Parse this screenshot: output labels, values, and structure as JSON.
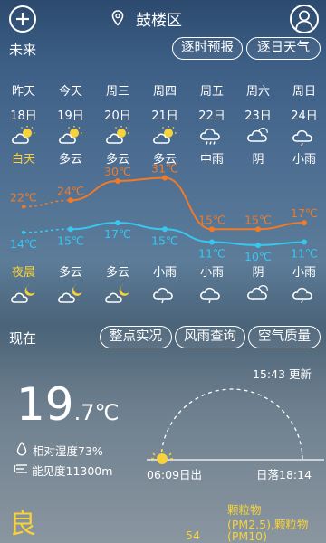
{
  "header": {
    "city": "鼓楼区",
    "add_icon": "plus-icon",
    "location_icon": "location-pin-icon",
    "user_icon": "user-icon"
  },
  "forecast": {
    "title": "未来",
    "hourly_button": "逐时预报",
    "daily_button": "逐日天气",
    "days": [
      {
        "day": "昨天",
        "date": "18日",
        "day_weather": "白天",
        "night_weather": "夜晨",
        "high": 22,
        "low": 14,
        "day_icon": "sunny-cloudy-icon",
        "night_icon": "moon-cloudy-icon",
        "high_label": "22℃",
        "low_label": "14℃"
      },
      {
        "day": "今天",
        "date": "19日",
        "day_weather": "多云",
        "night_weather": "多云",
        "high": 24,
        "low": 15,
        "day_icon": "sunny-cloudy-icon",
        "night_icon": "moon-cloudy-icon",
        "high_label": "24℃",
        "low_label": "15℃"
      },
      {
        "day": "周三",
        "date": "20日",
        "day_weather": "多云",
        "night_weather": "多云",
        "high": 30,
        "low": 17,
        "day_icon": "sunny-cloudy-icon",
        "night_icon": "moon-cloudy-icon",
        "high_label": "30℃",
        "low_label": "17℃"
      },
      {
        "day": "周四",
        "date": "21日",
        "day_weather": "多云",
        "night_weather": "小雨",
        "high": 31,
        "low": 15,
        "day_icon": "sunny-cloudy-icon",
        "night_icon": "light-rain-icon",
        "high_label": "31℃",
        "low_label": "15℃"
      },
      {
        "day": "周五",
        "date": "22日",
        "day_weather": "中雨",
        "night_weather": "小雨",
        "high": 15,
        "low": 11,
        "day_icon": "moderate-rain-icon",
        "night_icon": "light-rain-icon",
        "high_label": "15℃",
        "low_label": "11℃"
      },
      {
        "day": "周六",
        "date": "23日",
        "day_weather": "阴",
        "night_weather": "阴",
        "high": 15,
        "low": 10,
        "day_icon": "overcast-icon",
        "night_icon": "overcast-icon",
        "high_label": "15℃",
        "low_label": "10℃"
      },
      {
        "day": "周日",
        "date": "24日",
        "day_weather": "小雨",
        "night_weather": "小雨",
        "high": 17,
        "low": 11,
        "day_icon": "light-rain-icon",
        "night_icon": "light-rain-icon",
        "high_label": "17℃",
        "low_label": "11℃"
      }
    ]
  },
  "now": {
    "title": "现在",
    "btn_hourly_obs": "整点实况",
    "btn_wind_rain": "风雨查询",
    "btn_air": "空气质量",
    "updated": "15:43 更新",
    "temp_int": "19",
    "temp_dec": ".7℃",
    "humidity": "相对湿度73%",
    "visibility": "能见度11300m",
    "sunrise": "06:09日出",
    "sunset": "日落18:14"
  },
  "air": {
    "grade": "良",
    "aqi": "54",
    "pollutant_line1": "颗粒物",
    "pollutant_line2": "(PM2.5),颗粒物",
    "pollutant_line3": "(PM10)"
  },
  "colors": {
    "high": "#f07a28",
    "low": "#36c8f0",
    "yellow": "#f7d23a"
  }
}
